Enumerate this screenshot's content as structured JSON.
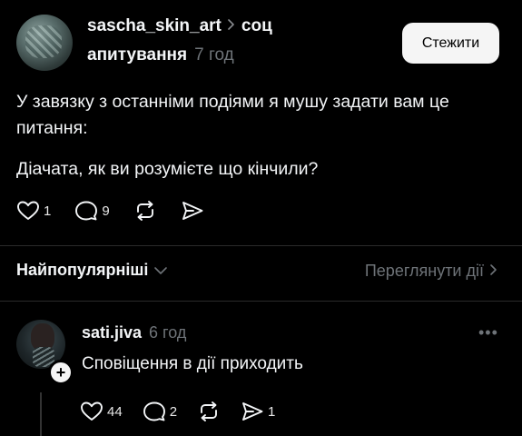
{
  "post": {
    "author": "sascha_skin_art",
    "topic_part1": "соц",
    "topic_part2": "апитування",
    "time": "7 год",
    "follow_label": "Стежити",
    "text_line1": "У завязку з останніми подіями я мушу задати вам це питання:",
    "text_line2": "Діачата, як ви розумієте що кінчили?",
    "likes": "1",
    "comments": "9"
  },
  "replies_header": {
    "sort_label": "Найпопулярніші",
    "view_activity": "Переглянути дії"
  },
  "reply": {
    "author": "sati.jiva",
    "time": "6 год",
    "text": "Сповіщення в дії приходить",
    "likes": "44",
    "comments": "2",
    "shares": "1",
    "more": "•••"
  },
  "colors": {
    "background": "#000000",
    "text": "#f3f5f7",
    "muted": "#6e7378",
    "button_bg": "#f5f5f5"
  }
}
